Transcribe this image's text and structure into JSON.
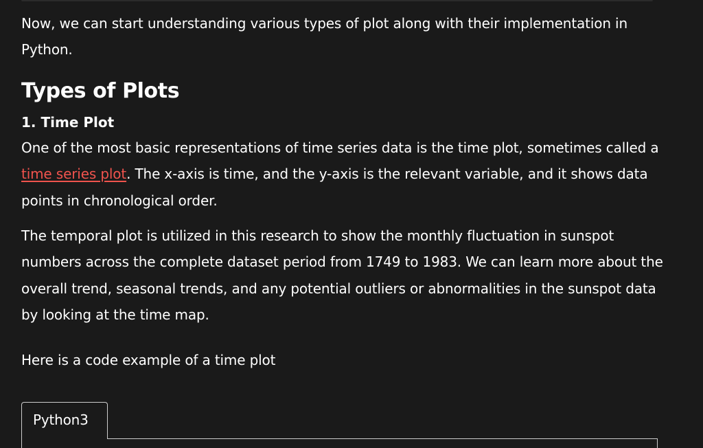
{
  "intro": "Now, we can start understanding various types of plot along with their implementation in Python.",
  "section_title": "Types of Plots",
  "subsection_title": "1. Time Plot",
  "para1": {
    "before": "One of the most basic representations of time series data is the time plot, sometimes called a ",
    "link": "time series plot",
    "after": ". The x-axis is time, and the y-axis is the relevant variable, and it shows data points in chronological order."
  },
  "para2": "The temporal plot is utilized in this research to show the monthly fluctuation in sunspot numbers across the complete dataset period from 1749 to 1983. We can learn more about the overall trend, seasonal trends, and any potential outliers or abnormalities in the sunspot data by looking at the time map.",
  "para3": "Here is a code example of a time plot",
  "code_tab": "Python3",
  "colors": {
    "background": "#1a1a1a",
    "text": "#ffffff",
    "link": "#f0534d",
    "border": "#cfcfcf"
  }
}
